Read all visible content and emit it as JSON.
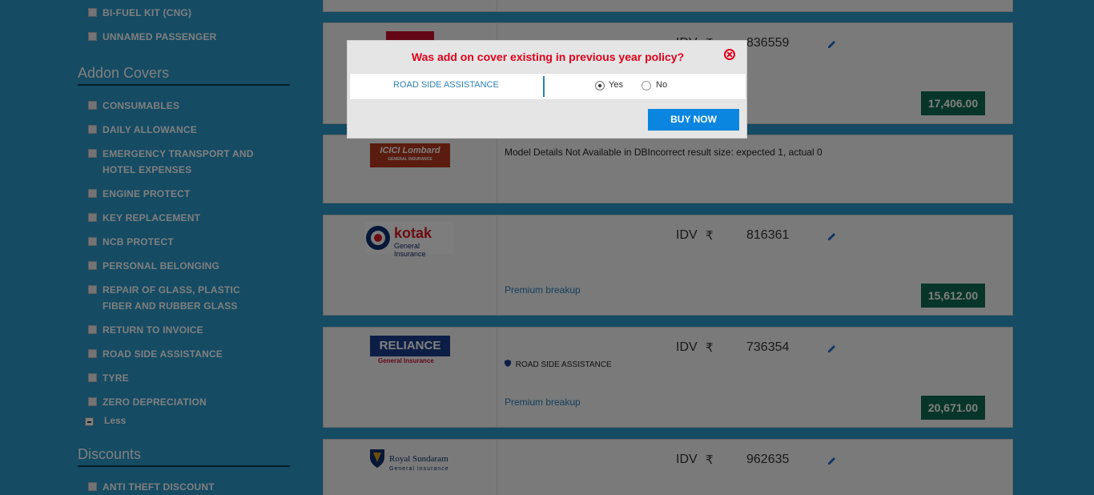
{
  "sidebar": {
    "top_items": [
      "BI-FUEL KIT (CNG)",
      "UNNAMED PASSENGER"
    ],
    "addon_title": "Addon Covers",
    "addon_items": [
      "CONSUMABLES",
      "DAILY ALLOWANCE",
      "EMERGENCY TRANSPORT AND HOTEL EXPENSES",
      "ENGINE PROTECT",
      "KEY REPLACEMENT",
      "NCB PROTECT",
      "PERSONAL BELONGING",
      "REPAIR OF GLASS, PLASTIC FIBER AND RUBBER GLASS",
      "RETURN TO INVOICE",
      "ROAD SIDE ASSISTANCE",
      "TYRE",
      "ZERO DEPRECIATION"
    ],
    "less_label": "Less",
    "discounts_title": "Discounts",
    "discount_items": [
      "ANTI THEFT DISCOUNT"
    ]
  },
  "quotes": [
    {
      "insurer": "",
      "idv_label": "IDV",
      "rupee": "₹",
      "idv": "836559",
      "price": "17,406.00"
    },
    {
      "insurer": "ICICI Lombard",
      "logo_text": "ICICI Lombard",
      "logo_sub": "GENERAL INSURANCE",
      "message": "Model Details Not Available in DBIncorrect result size: expected 1, actual 0"
    },
    {
      "insurer": "Kotak General Insurance",
      "logo_text": "kotak",
      "logo_sub": "General Insurance",
      "idv_label": "IDV",
      "rupee": "₹",
      "idv": "816361",
      "breakup": "Premium breakup",
      "price": "15,612.00"
    },
    {
      "insurer": "Reliance General Insurance",
      "logo_text": "RELIANCE",
      "logo_sub": "General Insurance",
      "idv_label": "IDV",
      "rupee": "₹",
      "idv": "736354",
      "cover_tag": "ROAD SIDE ASSISTANCE",
      "breakup": "Premium breakup",
      "price": "20,671.00"
    },
    {
      "insurer": "Royal Sundaram",
      "logo_text": "Royal Sundaram",
      "logo_sub": "General Insurance",
      "idv_label": "IDV",
      "rupee": "₹",
      "idv": "962635"
    }
  ],
  "modal": {
    "title": "Was add on cover existing in previous year policy?",
    "row_label": "ROAD SIDE ASSISTANCE",
    "yes_label": "Yes",
    "no_label": "No",
    "selected": "Yes",
    "buy_label": "BUY NOW"
  },
  "colors": {
    "title_red": "#e0001b",
    "buy_blue": "#0a86e0",
    "price_green": "#0f6b52",
    "link_blue": "#2a7fb8"
  }
}
